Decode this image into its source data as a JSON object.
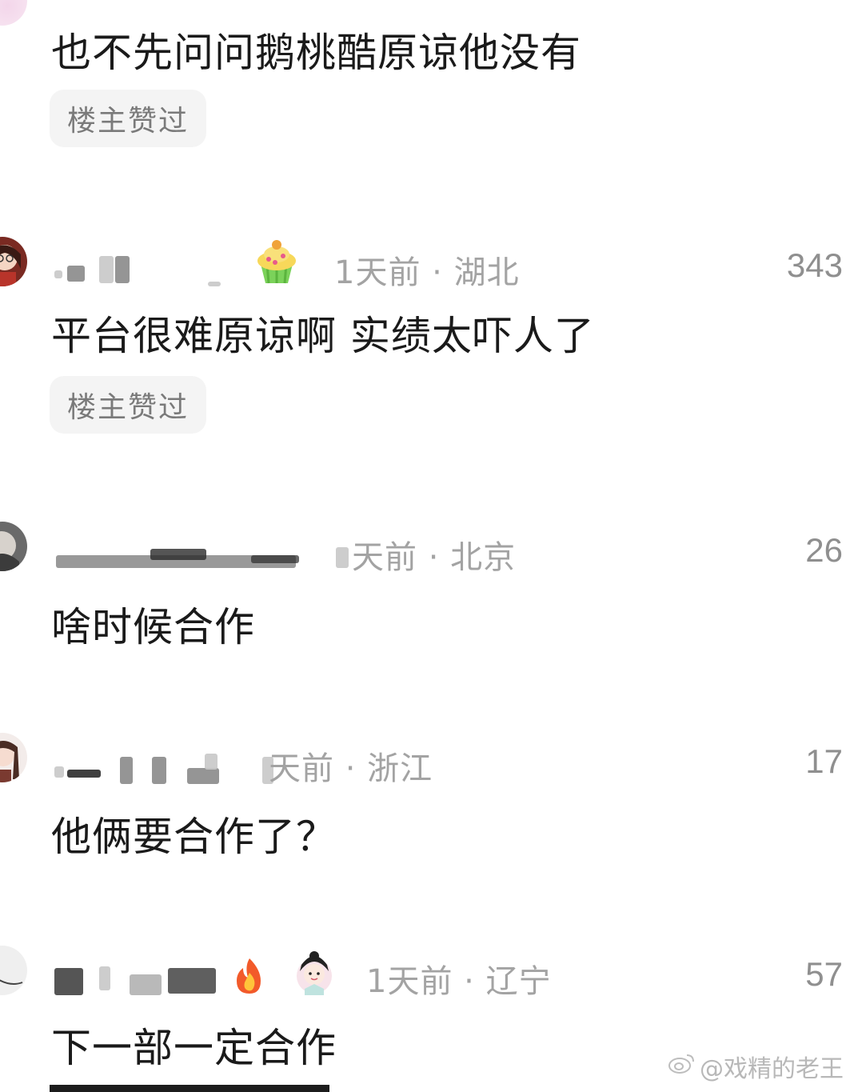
{
  "comments": [
    {
      "text": "也不先问问鹅桃酷原谅他没有",
      "badge": "楼主赞过"
    },
    {
      "time_location": "1天前 · 湖北",
      "likes": "343",
      "text": "平台很难原谅啊 实绩太吓人了",
      "badge": "楼主赞过",
      "emoji": "cupcake-emoji"
    },
    {
      "time_location": "天前 · 北京",
      "likes": "26",
      "text": "啥时候合作"
    },
    {
      "time_location": "天前 · 浙江",
      "likes": "17",
      "text": "他俩要合作了？"
    },
    {
      "time_location": "1天前 · 辽宁",
      "likes": "57",
      "text": "下一部一定合作",
      "emojis": [
        "fire-emoji",
        "girl-avatar-emoji"
      ]
    }
  ],
  "watermark": "@戏精的老王",
  "colors": {
    "meta_gray": "#a3a3a3",
    "badge_bg": "#f4f4f4",
    "text": "#1a1a1a"
  }
}
